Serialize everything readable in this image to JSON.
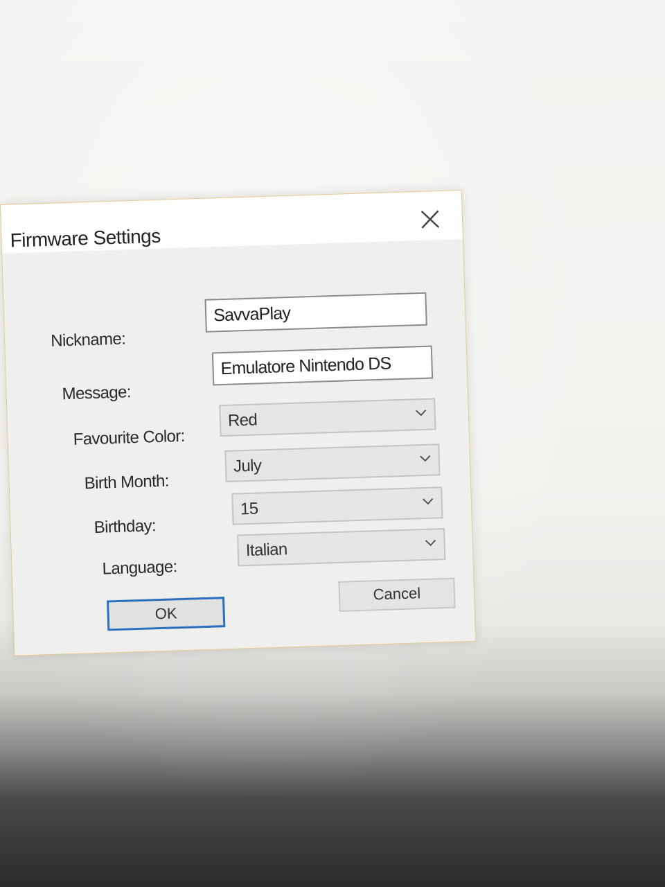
{
  "dialog": {
    "title": "Firmware Settings",
    "close_icon": "close-icon"
  },
  "form": {
    "nickname_label": "Nickname:",
    "nickname_value": "SavvaPlay",
    "message_label": "Message:",
    "message_value": "Emulatore Nintendo DS",
    "favourite_color_label": "Favourite Color:",
    "favourite_color_value": "Red",
    "birth_month_label": "Birth Month:",
    "birth_month_value": "July",
    "birthday_label": "Birthday:",
    "birthday_value": "15",
    "language_label": "Language:",
    "language_value": "Italian",
    "dropdown_icon": "chevron-down-icon"
  },
  "buttons": {
    "ok_label": "OK",
    "cancel_label": "Cancel"
  },
  "colors": {
    "focus_border": "#2c6fc0",
    "dialog_border": "#e3c98c"
  }
}
